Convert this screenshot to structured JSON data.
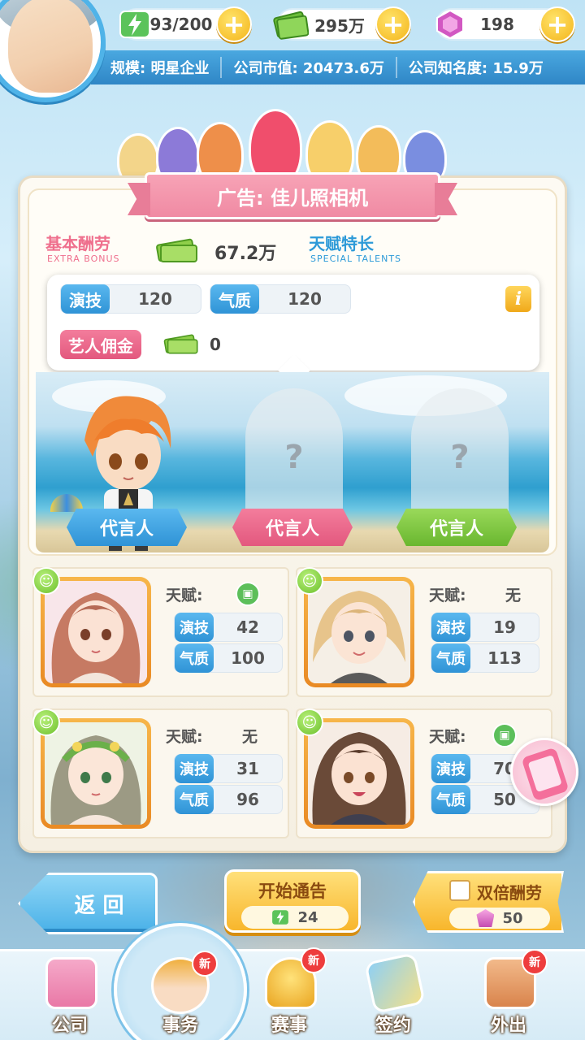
{
  "resources": {
    "energy": "93/200",
    "money": "295万",
    "gems": "198"
  },
  "company": {
    "scale": "规模: 明星企业",
    "market_value": "公司市值: 20473.6万",
    "fame": "公司知名度: 15.9万"
  },
  "ad": {
    "title": "广告: 佳儿照相机",
    "bonus_cn": "基本酬劳",
    "bonus_en": "EXTRA  BONUS",
    "bonus_value": "67.2万",
    "talent_cn": "天赋特长",
    "talent_en": "SPECIAL  TALENTS",
    "acting_label": "演技",
    "acting_value": "120",
    "temperament_label": "气质",
    "temperament_value": "120",
    "commission_label": "艺人佣金",
    "commission_value": "0",
    "info_icon": "i"
  },
  "spokespersons": [
    "代言人",
    "代言人",
    "代言人"
  ],
  "unknown_mark": "?",
  "artists": [
    {
      "talent_label": "天赋:",
      "talent": "",
      "has_talent_icon": true,
      "acting_label": "演技",
      "acting": "42",
      "temperament_label": "气质",
      "temperament": "100"
    },
    {
      "talent_label": "天赋:",
      "talent": "无",
      "has_talent_icon": false,
      "acting_label": "演技",
      "acting": "19",
      "temperament_label": "气质",
      "temperament": "113"
    },
    {
      "talent_label": "天赋:",
      "talent": "无",
      "has_talent_icon": false,
      "acting_label": "演技",
      "acting": "31",
      "temperament_label": "气质",
      "temperament": "96"
    },
    {
      "talent_label": "天赋:",
      "talent": "",
      "has_talent_icon": true,
      "acting_label": "演技",
      "acting": "70",
      "temperament_label": "气质",
      "temperament": "50"
    }
  ],
  "buttons": {
    "back": "返 回",
    "start": "开始通告",
    "start_cost": "24",
    "double": "双倍酬劳",
    "double_cost": "50"
  },
  "nav": {
    "items": [
      "公司",
      "事务",
      "赛事",
      "签约",
      "外出"
    ],
    "new_badge": "新"
  },
  "colors": {
    "accent_blue": "#2f93d6",
    "accent_pink": "#e3587e",
    "gold": "#f8b62c"
  }
}
